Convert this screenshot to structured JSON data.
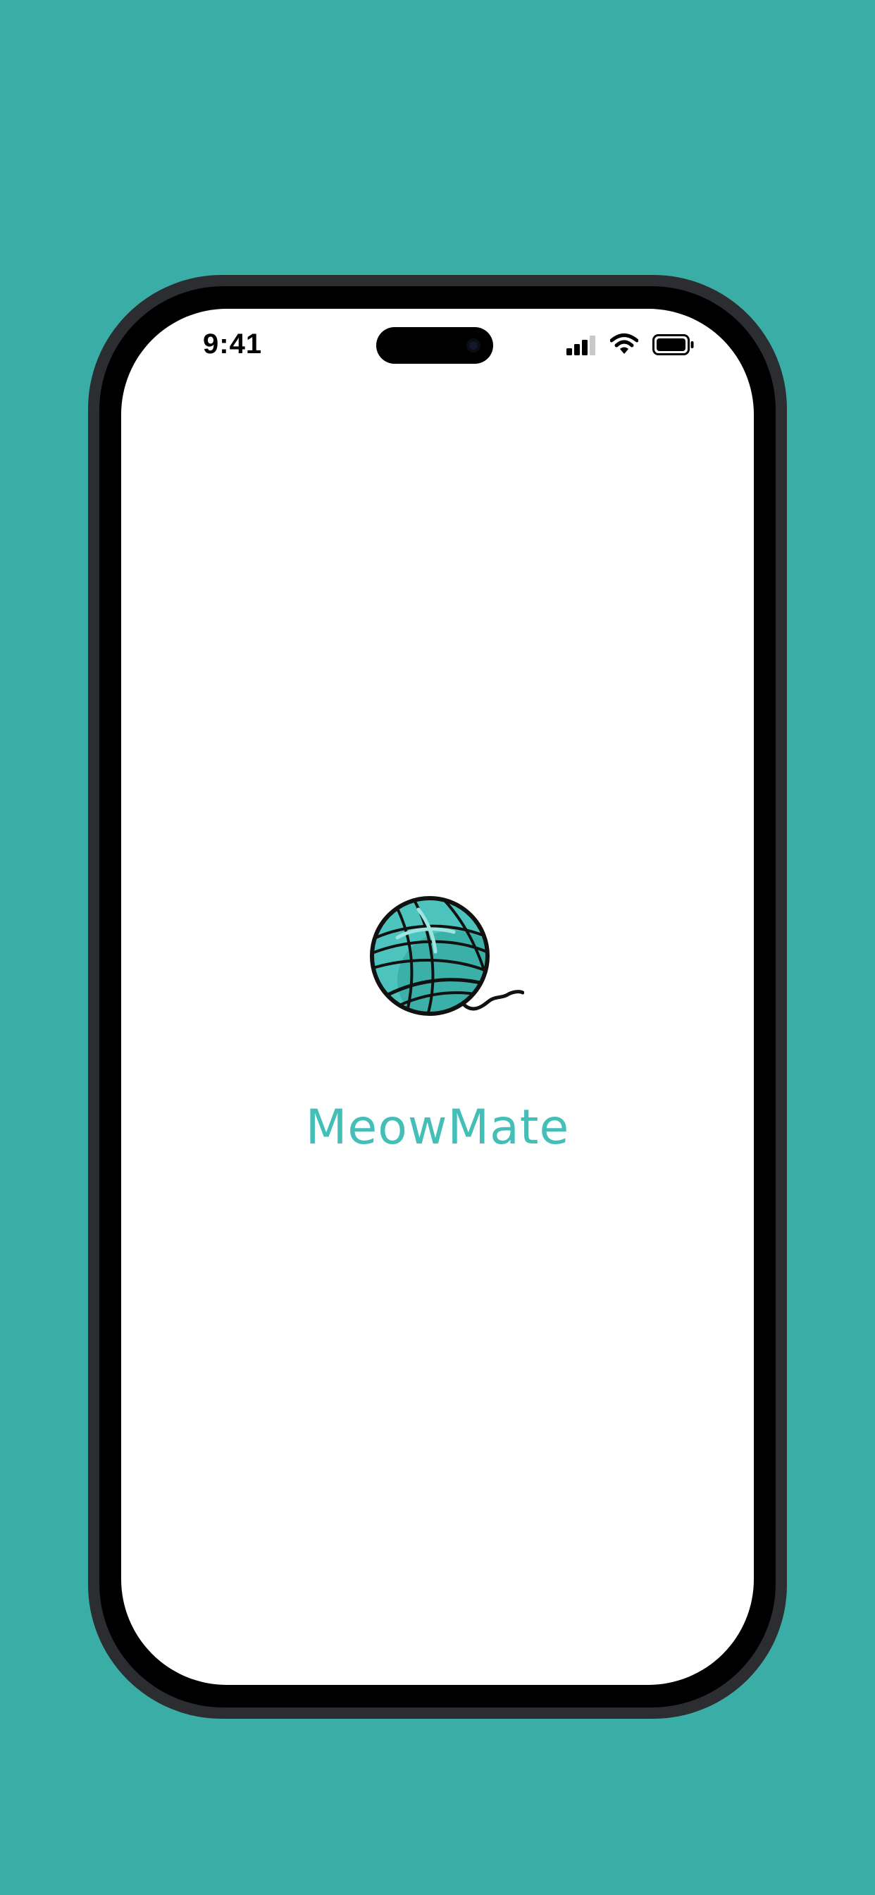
{
  "status_bar": {
    "time": "9:41",
    "icons": [
      "cellular-signal-icon",
      "wifi-icon",
      "battery-icon"
    ]
  },
  "splash": {
    "logo_icon": "yarn-ball-icon",
    "app_name": "MeowMate"
  },
  "colors": {
    "background": "#3aaea6",
    "accent": "#43bfb8",
    "yarn": "#4cc4bd",
    "screen": "#ffffff",
    "bezel": "#000000"
  }
}
